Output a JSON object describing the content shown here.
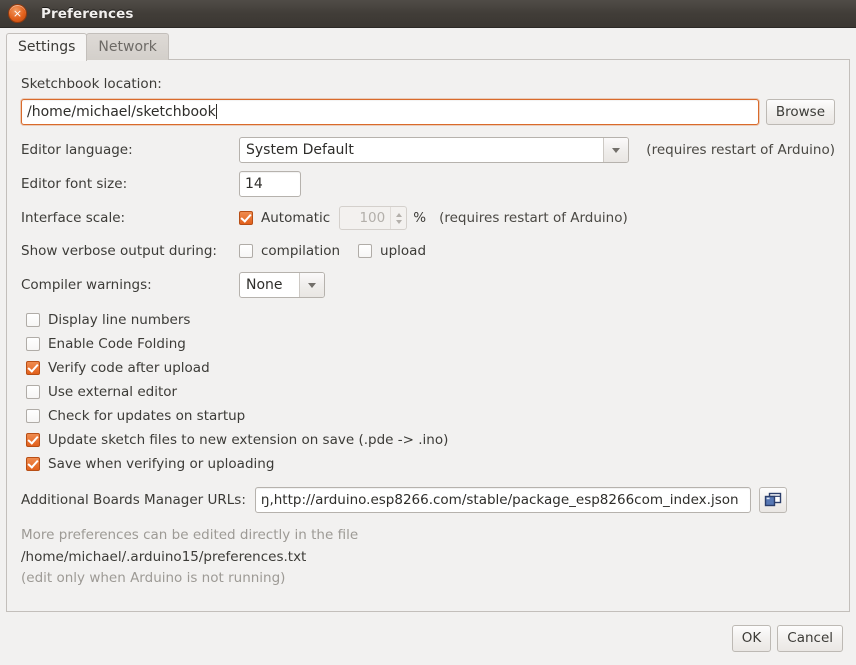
{
  "window": {
    "title": "Preferences",
    "close_icon": "close-icon",
    "close_glyph": "×"
  },
  "tabs": [
    {
      "label": "Settings",
      "active": true
    },
    {
      "label": "Network",
      "active": false
    }
  ],
  "settings": {
    "sketchbook": {
      "label": "Sketchbook location:",
      "value": "/home/michael/sketchbook",
      "browse_label": "Browse"
    },
    "editor_language": {
      "label": "Editor language:",
      "value": "System Default",
      "note": "(requires restart of Arduino)",
      "arrow_icon": "chevron-down-icon"
    },
    "editor_font_size": {
      "label": "Editor font size:",
      "value": "14"
    },
    "interface_scale": {
      "label": "Interface scale:",
      "automatic_label": "Automatic",
      "automatic_checked": true,
      "scale_value": "100",
      "percent_label": "%",
      "note": "(requires restart of Arduino)"
    },
    "verbose_output": {
      "label": "Show verbose output during:",
      "compilation_label": "compilation",
      "compilation_checked": false,
      "upload_label": "upload",
      "upload_checked": false
    },
    "compiler_warnings": {
      "label": "Compiler warnings:",
      "value": "None",
      "arrow_icon": "chevron-down-icon"
    },
    "options": [
      {
        "label": "Display line numbers",
        "checked": false
      },
      {
        "label": "Enable Code Folding",
        "checked": false
      },
      {
        "label": "Verify code after upload",
        "checked": true
      },
      {
        "label": "Use external editor",
        "checked": false
      },
      {
        "label": "Check for updates on startup",
        "checked": false
      },
      {
        "label": "Update sketch files to new extension on save (.pde -> .ino)",
        "checked": true
      },
      {
        "label": "Save when verifying or uploading",
        "checked": true
      }
    ],
    "boards_urls": {
      "label": "Additional Boards Manager URLs:",
      "value": "ŋ,http://arduino.esp8266.com/stable/package_esp8266com_index.json",
      "edit_icon": "open-windows-icon"
    },
    "footer_note_line1": "More preferences can be edited directly in the file",
    "footer_path": "/home/michael/.arduino15/preferences.txt",
    "footer_note_line3": "(edit only when Arduino is not running)"
  },
  "buttons": {
    "ok_label": "OK",
    "cancel_label": "Cancel"
  },
  "colors": {
    "accent": "#e2601b",
    "titlebar": "#413d38",
    "window_bg": "#f2f1f0",
    "focus_border": "#d96a2b"
  }
}
